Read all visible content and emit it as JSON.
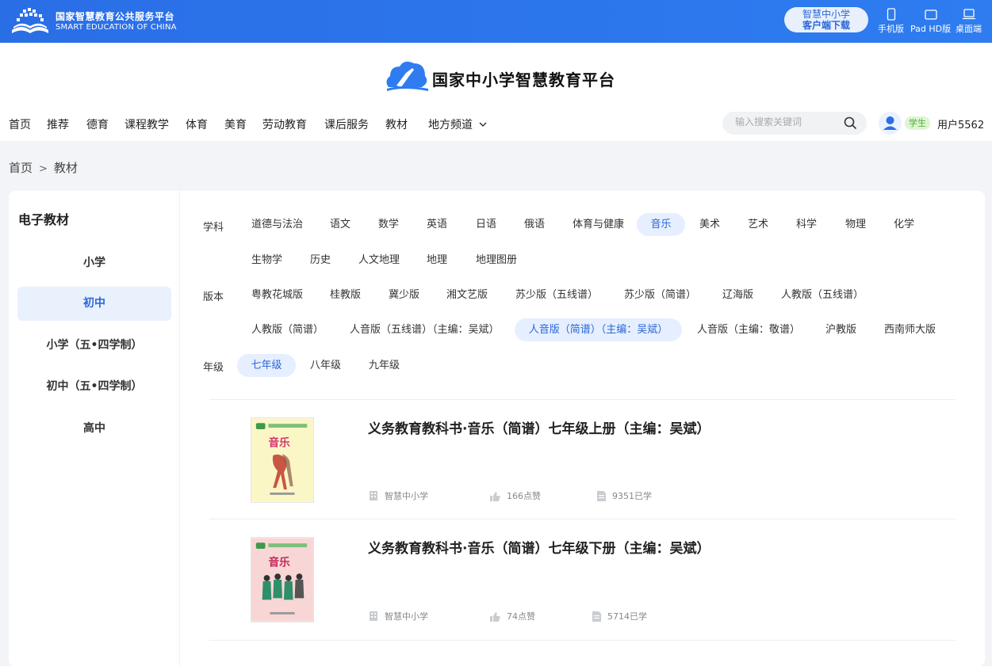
{
  "topbar": {
    "brand_cn": "国家智慧教育公共服务平台",
    "brand_en": "SMART EDUCATION OF CHINA",
    "download_line1": "智慧中小学",
    "download_line2": "客户端下载",
    "devices": [
      "手机版",
      "Pad HD版",
      "桌面端"
    ]
  },
  "header": {
    "site_title": "国家中小学智慧教育平台",
    "nav": [
      "首页",
      "推荐",
      "德育",
      "课程教学",
      "体育",
      "美育",
      "劳动教育",
      "课后服务",
      "教材",
      "地方频道"
    ],
    "search_placeholder": "输入搜索关键词",
    "role_badge": "学生",
    "username": "用户5562"
  },
  "breadcrumb": {
    "home": "首页",
    "separator": ">",
    "current": "教材"
  },
  "sidebar": {
    "title": "电子教材",
    "items": [
      "小学",
      "初中",
      "小学（五•四学制）",
      "初中（五•四学制）",
      "高中"
    ],
    "active": "初中"
  },
  "filters": {
    "subject_label": "学科",
    "subjects": [
      "道德与法治",
      "语文",
      "数学",
      "英语",
      "日语",
      "俄语",
      "体育与健康",
      "音乐",
      "美术",
      "艺术",
      "科学",
      "物理",
      "化学",
      "生物学",
      "历史",
      "人文地理",
      "地理",
      "地理图册"
    ],
    "subject_active": "音乐",
    "edition_label": "版本",
    "editions": [
      "粤教花城版",
      "桂教版",
      "冀少版",
      "湘文艺版",
      "苏少版（五线谱）",
      "苏少版（简谱）",
      "辽海版",
      "人教版（五线谱）",
      "人教版（简谱）",
      "人音版（五线谱）（主编：吴斌）",
      "人音版（简谱）（主编：吴斌）",
      "人音版（主编：敬谱）",
      "沪教版",
      "西南师大版"
    ],
    "edition_active": "人音版（简谱）（主编：吴斌）",
    "grade_label": "年级",
    "grades": [
      "七年级",
      "八年级",
      "九年级"
    ],
    "grade_active": "七年级"
  },
  "books": [
    {
      "title": "义务教育教科书·音乐（简谱）七年级上册（主编：吴斌）",
      "cover_text": "音乐",
      "source": "智慧中小学",
      "likes": "166点赞",
      "learners": "9351已学",
      "cover_color": "#fbf6c5"
    },
    {
      "title": "义务教育教科书·音乐（简谱）七年级下册（主编：吴斌）",
      "cover_text": "音乐",
      "source": "智慧中小学",
      "likes": "74点赞",
      "learners": "5714已学",
      "cover_color": "#f9d6d6"
    }
  ],
  "colors": {
    "primary": "#2e7cf0",
    "active_chip_bg": "#e6efff",
    "active_text": "#2a67d8"
  }
}
